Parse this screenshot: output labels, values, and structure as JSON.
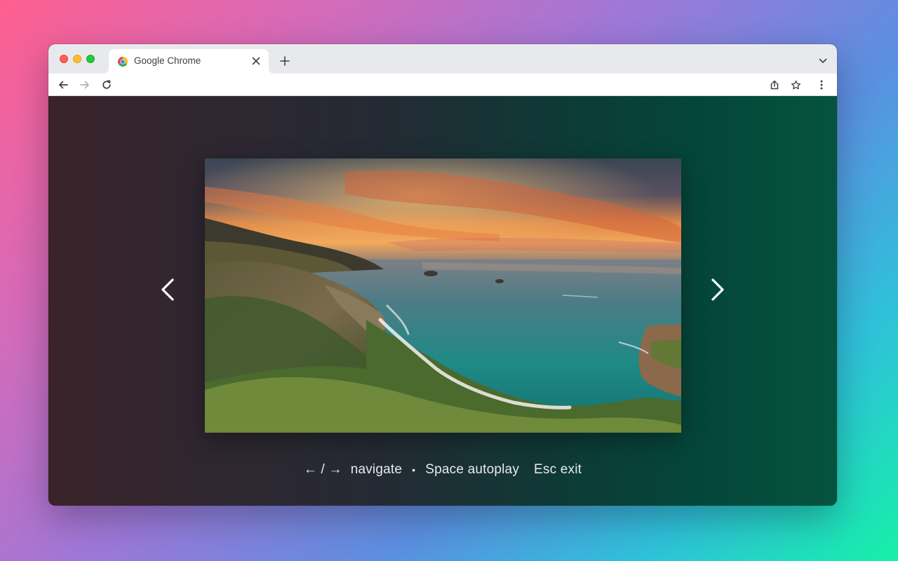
{
  "browser": {
    "tab": {
      "title": "Google Chrome",
      "favicon": "chrome-logo-icon",
      "close_icon": "close-icon"
    },
    "new_tab_icon": "plus-icon",
    "tab_search_icon": "chevron-down-icon",
    "toolbar": {
      "back_icon": "arrow-left-icon",
      "forward_icon": "arrow-right-icon",
      "reload_icon": "reload-icon",
      "address_value": "",
      "share_icon": "share-icon",
      "bookmark_icon": "star-icon",
      "menu_icon": "kebab-menu-icon"
    }
  },
  "viewer": {
    "prev_icon": "chevron-left-icon",
    "next_icon": "chevron-right-icon",
    "image": "coastal-sunset-photo",
    "hints": {
      "arrows": "← / →",
      "navigate": "navigate",
      "separator": "•",
      "autoplay": "Space autoplay",
      "exit": "Esc exit"
    }
  },
  "colors": {
    "tabbar": "#e8e9ed",
    "viewer_left": "#3a2329",
    "viewer_right": "#05533f"
  }
}
